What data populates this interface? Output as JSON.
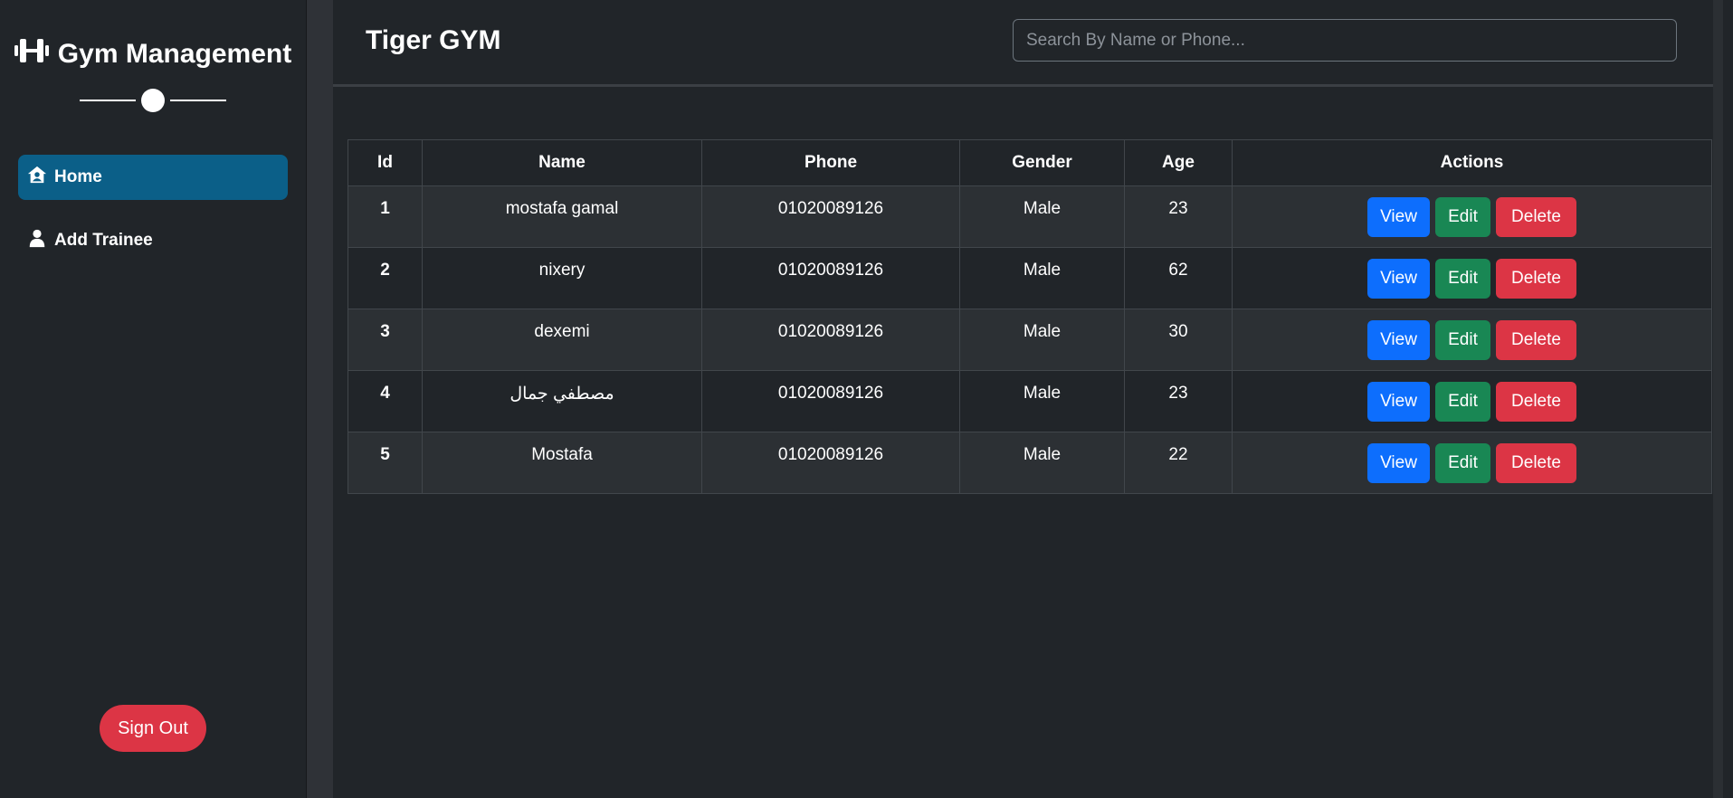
{
  "sidebar": {
    "brand": "Gym Management",
    "nav": [
      {
        "label": "Home",
        "icon": "home-user-icon",
        "active": true
      },
      {
        "label": "Add Trainee",
        "icon": "user-icon",
        "active": false
      }
    ],
    "signout_label": "Sign Out"
  },
  "header": {
    "title": "Tiger GYM",
    "search_placeholder": "Search By Name or Phone..."
  },
  "table": {
    "columns": [
      "Id",
      "Name",
      "Phone",
      "Gender",
      "Age",
      "Actions"
    ],
    "rows": [
      {
        "id": "1",
        "name": "mostafa gamal",
        "phone": "01020089126",
        "gender": "Male",
        "age": "23"
      },
      {
        "id": "2",
        "name": "nixery",
        "phone": "01020089126",
        "gender": "Male",
        "age": "62"
      },
      {
        "id": "3",
        "name": "dexemi",
        "phone": "01020089126",
        "gender": "Male",
        "age": "30"
      },
      {
        "id": "4",
        "name": "مصطفي جمال",
        "phone": "01020089126",
        "gender": "Male",
        "age": "23"
      },
      {
        "id": "5",
        "name": "Mostafa",
        "phone": "01020089126",
        "gender": "Male",
        "age": "22"
      }
    ],
    "action_labels": {
      "view": "View",
      "edit": "Edit",
      "delete": "Delete"
    }
  },
  "colors": {
    "background": "#212529",
    "active_nav": "#0b5f88",
    "view": "#0d6efd",
    "edit": "#198754",
    "delete": "#dc3545"
  }
}
